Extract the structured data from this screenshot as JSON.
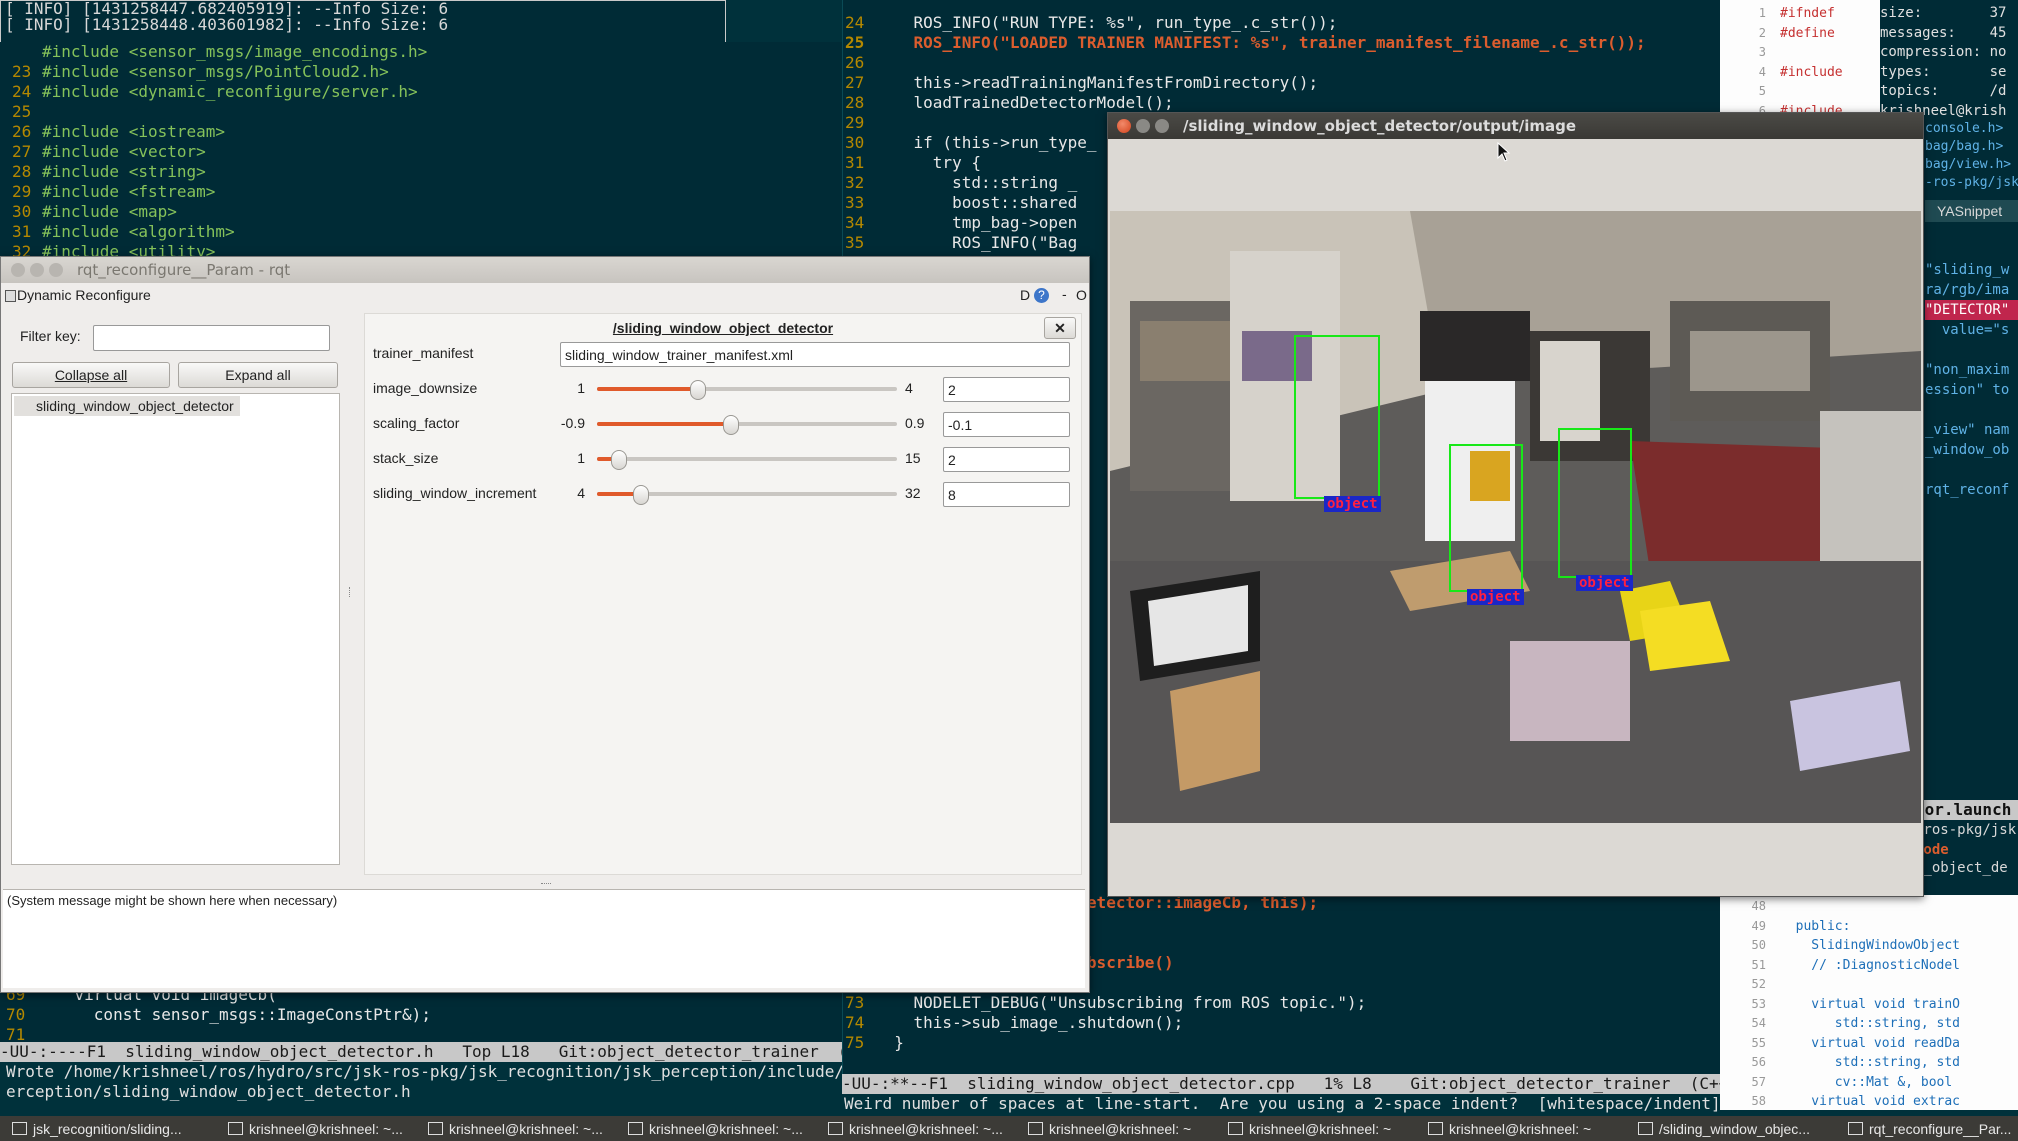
{
  "terminal_top": {
    "lines": [
      "[ INFO] [1431258447.682405919]: --Info Size: 6",
      "[ INFO] [1431258448.403601982]: --Info Size: 6"
    ]
  },
  "left_editor": {
    "lines_top": [
      {
        "n": "",
        "code": "#include <sensor_msgs/image_encodings.h>"
      },
      {
        "n": "23",
        "code": "#include <sensor_msgs/PointCloud2.h>"
      },
      {
        "n": "24",
        "code": "#include <dynamic_reconfigure/server.h>"
      },
      {
        "n": "25",
        "code": ""
      },
      {
        "n": "26",
        "code": "#include <iostream>"
      },
      {
        "n": "27",
        "code": "#include <vector>"
      },
      {
        "n": "28",
        "code": "#include <string>"
      },
      {
        "n": "29",
        "code": "#include <fstream>"
      },
      {
        "n": "30",
        "code": "#include <map>"
      },
      {
        "n": "31",
        "code": "#include <algorithm>"
      },
      {
        "n": "32",
        "code": "#include <utility>"
      }
    ],
    "lines_bottom": [
      {
        "n": "69",
        "code": "    virtual void imageCb("
      },
      {
        "n": "70",
        "code": "      const sensor_msgs::ImageConstPtr&);"
      },
      {
        "n": "71",
        "code": ""
      }
    ],
    "modeline": "-UU-:----F1  sliding_window_object_detector.h   Top L18   Git:object_detector_trainer  (C++/l",
    "minibuffer": "Wrote /home/krishneel/ros/hydro/src/jsk-ros-pkg/jsk_recognition/jsk_perception/include/jsk_p\\\nerception/sliding_window_object_detector.h"
  },
  "mid_editor": {
    "lines": [
      {
        "n": "24",
        "code": "    ROS_INFO(\"RUN TYPE: %s\", run_type_.c_str());"
      },
      {
        "n": "25",
        "code": "    ROS_INFO(\"LOADED TRAINER MANIFEST: %s\", trainer_manifest_filename_.c_str());"
      },
      {
        "n": "26",
        "code": ""
      },
      {
        "n": "27",
        "code": "    this->readTrainingManifestFromDirectory();"
      },
      {
        "n": "28",
        "code": "    loadTrainedDetectorModel();"
      },
      {
        "n": "29",
        "code": ""
      },
      {
        "n": "30",
        "code": "    if (this->run_type_"
      },
      {
        "n": "31",
        "code": "      try {"
      },
      {
        "n": "32",
        "code": "        std::string _"
      },
      {
        "n": "33",
        "code": "        boost::shared"
      },
      {
        "n": "34",
        "code": "        tmp_bag->open"
      },
      {
        "n": "35",
        "code": "        ROS_INFO(\"Bag"
      }
    ],
    "lines_bottom": [
      {
        "n": "",
        "code": "  slidingWindowObjectDetector::imageCb, this);"
      },
      {
        "n": "",
        "code": ""
      },
      {
        "n": "",
        "code": ""
      },
      {
        "n": "",
        "code": "  ObjectDetector::unsubscribe()"
      },
      {
        "n": "",
        "code": ""
      },
      {
        "n": "73",
        "code": "    NODELET_DEBUG(\"Unsubscribing from ROS topic.\");"
      },
      {
        "n": "74",
        "code": "    this->sub_image_.shutdown();"
      },
      {
        "n": "75",
        "code": "  }"
      }
    ],
    "modeline": "-UU-:**--F1  sliding_window_object_detector.cpp   1% L8    Git:object_detector_trainer  (C++/lah",
    "minibuffer": "Weird number of spaces at line-start.  Are you using a 2-space indent?  [whitespace/indent] [3]"
  },
  "right_panel": {
    "lines": [
      {
        "n": "1",
        "code": "#ifndef"
      },
      {
        "n": "2",
        "code": "#define"
      },
      {
        "n": "3",
        "code": ""
      },
      {
        "n": "4",
        "code": "#include"
      },
      {
        "n": "5",
        "code": ""
      },
      {
        "n": "6",
        "code": "#include"
      }
    ],
    "info": [
      "size:        37",
      "messages:    45",
      "compression: no",
      "types:       se",
      "topics:      /d",
      "krishneel@krish"
    ],
    "snippets": [
      "console.h>",
      "bag/bag.h>",
      "bag/view.h>",
      "-ros-pkg/jsk",
      "YASnippet"
    ],
    "launch_lines": [
      "\"sliding_w",
      "ra/rgb/ima",
      "\"DETECTOR\"",
      "  value=\"s",
      "",
      "\"non_maxim",
      "ession\" to",
      "",
      "_view\" nam",
      "_window_ob",
      "",
      "rqt_reconf"
    ],
    "launch_title": "tor.launch",
    "launch_path": "-ros-pkg/jsk",
    "launch_mode": "node",
    "launch_obj": "w_object_de",
    "bottom_lines": [
      {
        "n": "48",
        "code": ""
      },
      {
        "n": "49",
        "code": "  public:"
      },
      {
        "n": "50",
        "code": "    SlidingWindowObject"
      },
      {
        "n": "51",
        "code": "    // :DiagnosticNodel"
      },
      {
        "n": "52",
        "code": ""
      },
      {
        "n": "53",
        "code": "    virtual void trainO"
      },
      {
        "n": "54",
        "code": "       std::string, std"
      },
      {
        "n": "55",
        "code": "    virtual void readDa"
      },
      {
        "n": "56",
        "code": "       std::string, std"
      },
      {
        "n": "57",
        "code": "       cv::Mat &, bool "
      },
      {
        "n": "58",
        "code": "    virtual void extrac"
      }
    ]
  },
  "rqt": {
    "title": "rqt_reconfigure__Param - rqt",
    "plugin_title": "Dynamic Reconfigure",
    "plugin_controls": "D",
    "filter_label": "Filter key:",
    "filter_value": "",
    "collapse_label": "Collapse all",
    "expand_label": "Expand all",
    "tree_items": [
      "sliding_window_object_detector"
    ],
    "node_title": "/sliding_window_object_detector",
    "params": [
      {
        "name": "trainer_manifest",
        "type": "text",
        "value": "sliding_window_trainer_manifest.xml"
      },
      {
        "name": "image_downsize",
        "type": "slider",
        "min": "1",
        "max": "4",
        "value": "2",
        "fraction": 0.333
      },
      {
        "name": "scaling_factor",
        "type": "slider",
        "min": "-0.9",
        "max": "0.9",
        "value": "-0.1",
        "fraction": 0.444
      },
      {
        "name": "stack_size",
        "type": "slider",
        "min": "1",
        "max": "15",
        "value": "2",
        "fraction": 0.071
      },
      {
        "name": "sliding_window_increment",
        "type": "slider",
        "min": "4",
        "max": "32",
        "value": "8",
        "fraction": 0.143
      }
    ],
    "status_message": "(System message might be shown here when necessary)"
  },
  "image_view": {
    "title": "/sliding_window_object_detector/output/image",
    "detections": [
      {
        "label": "object"
      },
      {
        "label": "object"
      },
      {
        "label": "object"
      }
    ]
  },
  "taskbar": {
    "items": [
      "jsk_recognition/sliding...",
      "krishneel@krishneel: ~...",
      "krishneel@krishneel: ~...",
      "krishneel@krishneel: ~...",
      "krishneel@krishneel: ~...",
      "krishneel@krishneel: ~",
      "krishneel@krishneel: ~",
      "krishneel@krishneel: ~",
      "/sliding_window_objec...",
      "rqt_reconfigure__Par..."
    ]
  }
}
